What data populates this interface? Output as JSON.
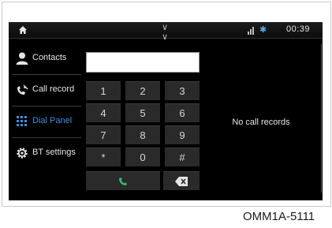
{
  "status_bar": {
    "time": "00:39"
  },
  "menu": {
    "items": [
      {
        "label": "Contacts"
      },
      {
        "label": "Call record"
      },
      {
        "label": "Dial Panel"
      },
      {
        "label": "BT settings"
      }
    ],
    "active": "Dial Panel"
  },
  "dial_input": {
    "value": ""
  },
  "keypad": [
    "1",
    "2",
    "3",
    "4",
    "5",
    "6",
    "7",
    "8",
    "9",
    "*",
    "0",
    "#"
  ],
  "call_records": {
    "empty_message": "No call records"
  },
  "colors": {
    "accent": "#3d8ee0",
    "bluetooth": "#5ea7e8",
    "call": "#2fbf71"
  },
  "figure_code": "OMM1A-5111"
}
